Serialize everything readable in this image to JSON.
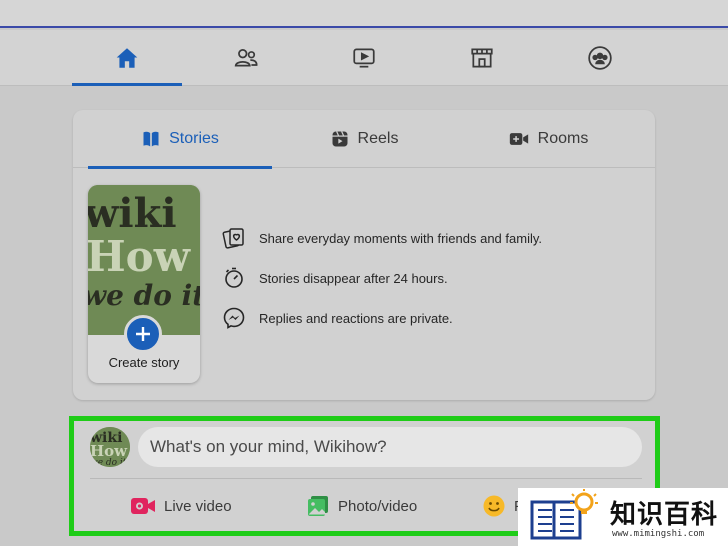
{
  "nav": {
    "items": [
      {
        "name": "home",
        "icon": "home-icon",
        "active": true
      },
      {
        "name": "friends",
        "icon": "friends-icon",
        "active": false
      },
      {
        "name": "watch",
        "icon": "video-play-icon",
        "active": false
      },
      {
        "name": "marketplace",
        "icon": "store-icon",
        "active": false
      },
      {
        "name": "groups",
        "icon": "groups-icon",
        "active": false
      }
    ]
  },
  "stories_card": {
    "tabs": [
      {
        "label": "Stories",
        "icon": "book-icon",
        "active": true
      },
      {
        "label": "Reels",
        "icon": "reels-icon",
        "active": false
      },
      {
        "label": "Rooms",
        "icon": "video-camera-plus-icon",
        "active": false
      }
    ],
    "create_story": {
      "label": "Create story",
      "image_logo_lines": [
        "wiki",
        "How",
        "we do it"
      ]
    },
    "info": [
      {
        "icon": "photo-heart-icon",
        "text": "Share everyday moments with friends and family."
      },
      {
        "icon": "stopwatch-icon",
        "text": "Stories disappear after 24 hours."
      },
      {
        "icon": "messenger-icon",
        "text": "Replies and reactions are private."
      }
    ]
  },
  "post_composer": {
    "placeholder": "What's on your mind, Wikihow?",
    "actions": [
      {
        "label": "Live video",
        "icon": "live-video-icon"
      },
      {
        "label": "Photo/video",
        "icon": "photo-icon"
      },
      {
        "label": "F",
        "icon": "feeling-icon"
      }
    ]
  },
  "watermark": {
    "chinese": "知识百科",
    "url": "www.mimingshi.com"
  },
  "colors": {
    "accent": "#1b5fb8",
    "highlight": "#1fcc18",
    "background": "#c9c9c9",
    "live": "#e0245e",
    "photo": "#45bd62",
    "feeling": "#f7b928"
  }
}
